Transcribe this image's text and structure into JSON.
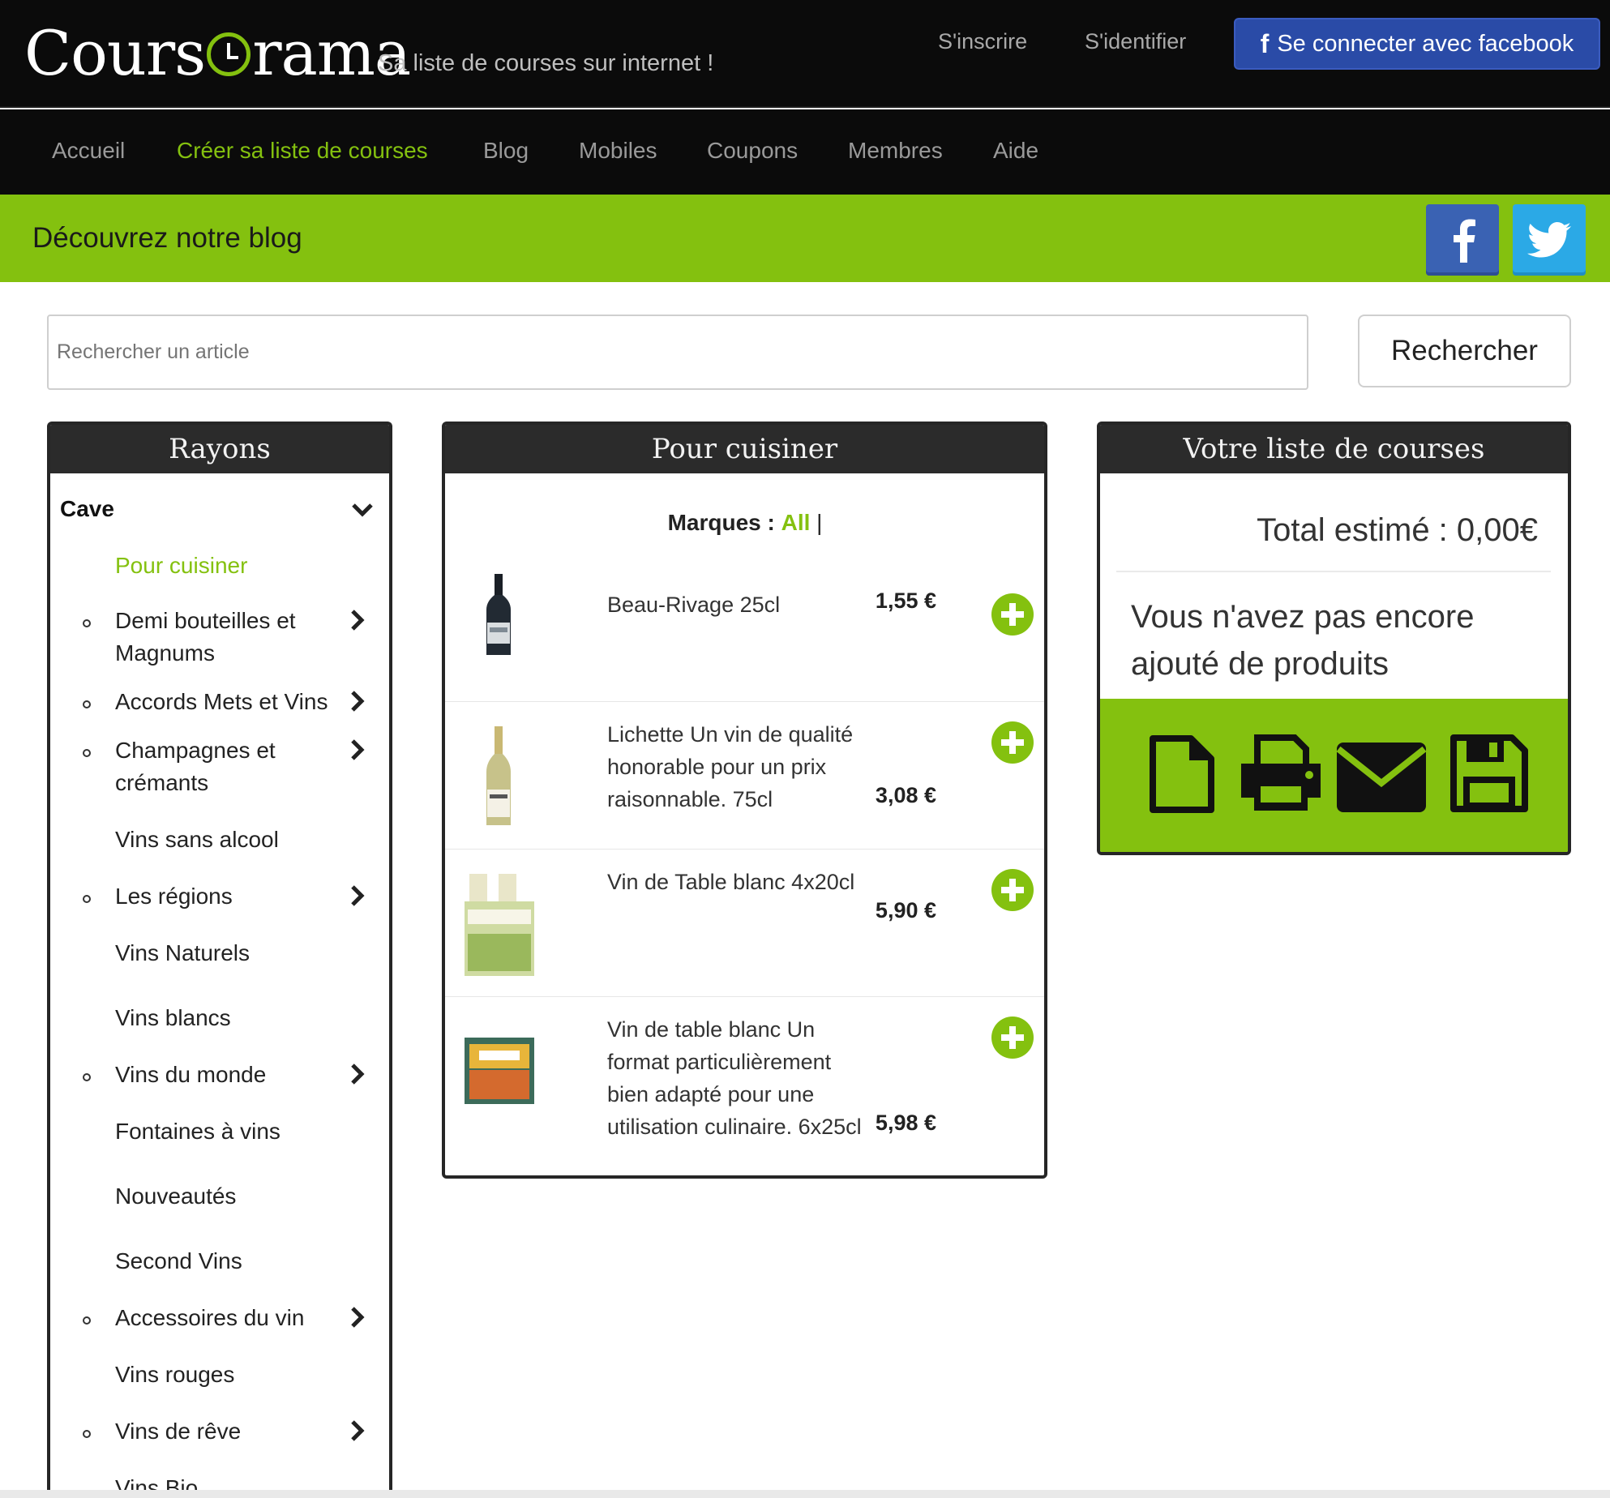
{
  "header": {
    "logo_text": "CoursOrama",
    "tagline": "Sa liste de courses sur internet !",
    "signup_label": "S'inscrire",
    "login_label": "S'identifier",
    "facebook_label": "Se connecter avec facebook"
  },
  "nav": {
    "items": [
      {
        "label": "Accueil"
      },
      {
        "label": "Créer sa liste de courses",
        "active": true
      },
      {
        "label": "Blog"
      },
      {
        "label": "Mobiles"
      },
      {
        "label": "Coupons"
      },
      {
        "label": "Membres"
      },
      {
        "label": "Aide"
      }
    ]
  },
  "banner": {
    "title": "Découvrez notre blog",
    "social": [
      "facebook-icon",
      "twitter-icon"
    ]
  },
  "search": {
    "placeholder": "Rechercher un article",
    "button_label": "Rechercher"
  },
  "rayons": {
    "title": "Rayons",
    "category": "Cave",
    "items": [
      {
        "label": "Pour cuisiner",
        "active": true,
        "bullet": false,
        "submenu": false
      },
      {
        "label": "Demi bouteilles et Magnums",
        "bullet": true,
        "submenu": true
      },
      {
        "label": "Accords Mets et Vins",
        "bullet": true,
        "submenu": true
      },
      {
        "label": "Champagnes et crémants",
        "bullet": true,
        "submenu": true
      },
      {
        "label": "Vins sans alcool",
        "bullet": false,
        "submenu": false
      },
      {
        "label": "Les régions",
        "bullet": true,
        "submenu": true
      },
      {
        "label": "Vins Naturels",
        "bullet": false,
        "submenu": false
      },
      {
        "label": "Vins blancs",
        "bullet": false,
        "submenu": false
      },
      {
        "label": "Vins du monde",
        "bullet": true,
        "submenu": true
      },
      {
        "label": "Fontaines à vins",
        "bullet": false,
        "submenu": false
      },
      {
        "label": "Nouveautés",
        "bullet": false,
        "submenu": false
      },
      {
        "label": "Second Vins",
        "bullet": false,
        "submenu": false
      },
      {
        "label": "Accessoires du vin",
        "bullet": true,
        "submenu": true
      },
      {
        "label": "Vins rouges",
        "bullet": false,
        "submenu": false
      },
      {
        "label": "Vins de rêve",
        "bullet": true,
        "submenu": true
      },
      {
        "label": "Vins Bio",
        "bullet": false,
        "submenu": false
      }
    ]
  },
  "products_panel": {
    "title": "Pour cuisiner",
    "brands_label": "Marques :",
    "brands_all": "All",
    "brands_sep": "|",
    "products": [
      {
        "name": "Beau-Rivage 25cl",
        "price": "1,55 €"
      },
      {
        "name": "Lichette Un vin de qualité honorable pour un prix raisonnable. 75cl",
        "price": "3,08 €"
      },
      {
        "name": "Vin de Table blanc 4x20cl",
        "price": "5,90 €"
      },
      {
        "name": "Vin de table blanc Un format particulièrement bien adapté pour une utilisation culinaire. 6x25cl",
        "price": "5,98 €"
      }
    ]
  },
  "shopping_list": {
    "title": "Votre liste de courses",
    "total": "Total estimé : 0,00€",
    "empty_message": "Vous n'avez pas encore ajouté de produits",
    "actions": [
      "document-icon",
      "print-icon",
      "email-icon",
      "save-icon"
    ]
  },
  "colors": {
    "accent": "#84c10f",
    "dark": "#0b0b0b",
    "facebook": "#2a4ba7",
    "twitter": "#2ba9e6"
  }
}
